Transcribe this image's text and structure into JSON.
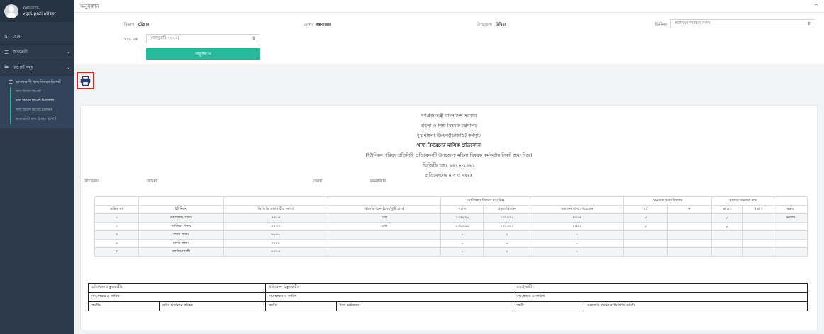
{
  "user": {
    "welcome": "Welcome,",
    "name": "vgdUpazilaUser"
  },
  "sidebar": {
    "items": [
      {
        "icon": "home-icon",
        "label": "হোম"
      },
      {
        "icon": "list-icon",
        "label": "জনতেরী"
      },
      {
        "icon": "list-icon",
        "label": "রিপোর্ট সমূহ"
      }
    ],
    "submenu_title": "ভাতাভোগী খাদ্য বিতরণ রিপোর্ট",
    "submenu_items": [
      "খাদ্য বিতরণ রিপোর্ট",
      "খাদ্য বিতরণ রিপোর্ট উপজেলা",
      "খাদ্য বিতরণ রিপোর্ট ইউনিয়ন",
      "ভাতাভোগী খাদ্য বিতরণ রিপোর্ট"
    ]
  },
  "topbar": {
    "title": "অনুসন্ধান",
    "collapse": "^"
  },
  "filters": {
    "division_label": "বিভাগ",
    "division_value": "চট্টগ্রাম",
    "district_label": "জেলা",
    "district_value": "কক্সবাজার",
    "upazila_label": "উপজেলা",
    "upazila_value": "উখিয়া",
    "union_label": "ইউনিয়ন",
    "union_value": "ইউনিয়ন নির্বাচন করুন",
    "cycle_label": "খাদ্য চক্র",
    "cycle_value": "(জানুয়ারি-২০২১)",
    "search_button": "অনুসন্ধান"
  },
  "report": {
    "lines": [
      "গণপ্রজাতন্ত্রী বাংলাদেশ সরকার",
      "মহিলা ও শিশু বিষয়ক মন্ত্রণালয়",
      "দুস্থ মহিলা উন্নয়ন(ভিজিডি) কর্মসূচি",
      "খাদ্য বিতরনের মাসিক প্রতিবেদন",
      "(ইউনিয়ন পরিষদ প্রতিনিধি প্রতিবেদনটি উপজেলা মহিলা বিষয়ক কর্মকর্তার নিকট জমা দিবে)",
      "ভিজিডি চক্রঃ ২০২০-২০২১",
      "প্রতিবেদনের মাস ও বছরঃ"
    ],
    "upazila_label": "উপজেলা",
    "upazila_value": "উখিয়া",
    "district_label": "জেলা",
    "district_value": "কক্সবাজার",
    "table": {
      "group_total": "মোট খাদ্য বিতরণ (মে:টন)",
      "group_time": "সময়মত খাদ্য বিতরণ",
      "group_quality": "খাদ্যের গুনগত মান",
      "headers": [
        "ক্রমিক নং",
        "ইউনিয়ন",
        "ভিজিডি কার্ডধারীর সংখ্যা",
        "খাদ্যের ধরন (চাল/পুষ্টি চাল)",
        "বরাদ্দ",
        "প্রকৃত বিতরন",
        "কতজন খাদ্য পেয়েছেন",
        "হ্যাঁ",
        "না",
        "ভালো",
        "খারাপ",
        "মন্তব্য"
      ],
      "rows": [
        [
          "১",
          "রত্নাপালং পালং",
          "৪৬১৬",
          "চাল",
          "১৩৭৪৭০",
          "১৩৭৪৭০",
          "৪৬১৬",
          "✓",
          "",
          "✓",
          "",
          "ভালো"
        ],
        [
          "২",
          "জালিয়া পালং",
          "৪৫৩৩",
          "চাল",
          "১৩১৪৯০",
          "১৩১৪৯০",
          "৪৫৩২",
          "✓",
          "",
          "✓",
          "",
          ""
        ],
        [
          "৩",
          "রাজা পালং",
          "৬০৪০",
          "",
          "০",
          "০",
          "০",
          "",
          "",
          "",
          "",
          ""
        ],
        [
          "৪",
          "হলদি পালং",
          "৩২৫৮",
          "",
          "০",
          "০",
          "০",
          "",
          "",
          "",
          "",
          ""
        ],
        [
          "৫",
          "জালিয়াপালী",
          "৮৩২৪",
          "",
          "০",
          "০",
          "০",
          "",
          "",
          "",
          "",
          ""
        ]
      ]
    },
    "footer": {
      "r1": [
        "প্রতিবেদন প্রস্তুতকারীঃ",
        "প্রতিবেদন প্রস্তুতকারীঃ",
        "যাচাই কারীঃ"
      ],
      "r2": [
        "নাম,স্বাক্ষর ও তারিখ",
        "নাম,স্বাক্ষর ও তারিখ",
        "নাম,স্বাক্ষর ও তারিখ"
      ],
      "r3": [
        "পদবীঃ",
        "সচিব ইউনিয়ন পরিষদ",
        "পদবীঃ",
        "ট্যাগ অফিসার",
        "পদবী",
        "সভাপতি,ইউনিয়ন ভিজিডি কমিটি"
      ]
    }
  }
}
